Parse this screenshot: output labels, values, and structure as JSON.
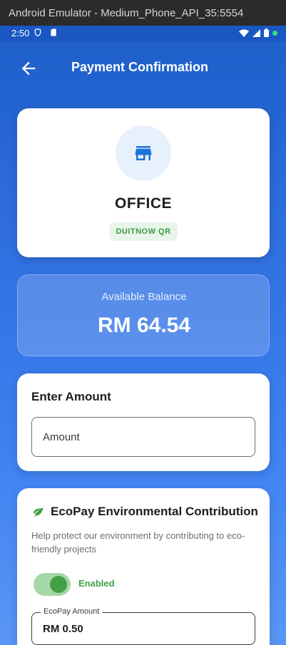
{
  "window": {
    "title": "Android Emulator - Medium_Phone_API_35:5554"
  },
  "status_bar": {
    "time": "2:50"
  },
  "app_bar": {
    "title": "Payment Confirmation"
  },
  "merchant": {
    "name": "OFFICE",
    "badge": "DUITNOW QR",
    "icon": "storefront-icon"
  },
  "balance": {
    "label": "Available Balance",
    "amount": "RM 64.54"
  },
  "amount_section": {
    "title": "Enter Amount",
    "placeholder": "Amount"
  },
  "ecopay": {
    "title": "EcoPay Environmental Contribution",
    "description": "Help protect our environment by contributing to eco-friendly projects",
    "toggle_label": "Enabled",
    "toggle_on": true,
    "field_label": "EcoPay Amount",
    "field_value": "RM 0.50"
  },
  "colors": {
    "primary": "#2f6fe0",
    "eco_green": "#43a047",
    "badge_bg": "#e8f5e9"
  }
}
